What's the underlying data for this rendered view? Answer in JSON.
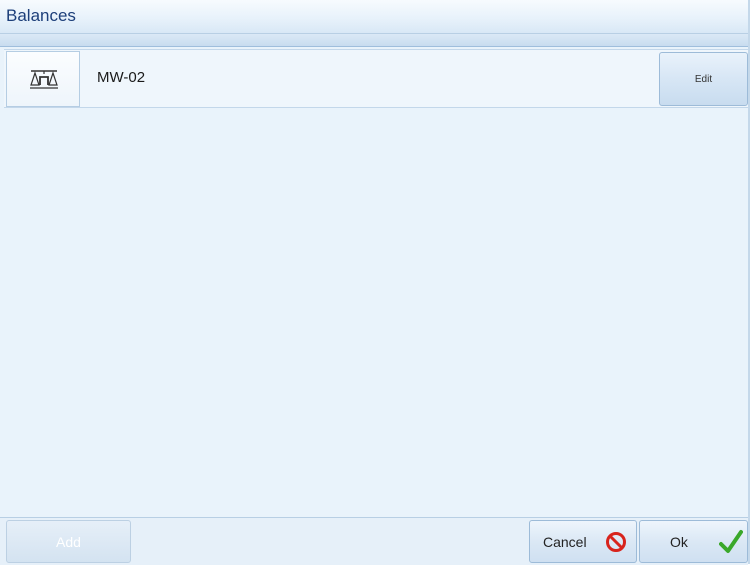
{
  "window": {
    "title": "Balances"
  },
  "balances": [
    {
      "name": "MW-02",
      "icon": "balance-scale-icon",
      "edit_label": "Edit"
    }
  ],
  "footer": {
    "add_label": "Add",
    "cancel_label": "Cancel",
    "cancel_icon": "prohibited-icon",
    "ok_label": "Ok",
    "ok_icon": "checkmark-icon"
  },
  "colors": {
    "title_text": "#1d3f7a",
    "background": "#e9f3fb",
    "cancel_icon": "#d8231c",
    "ok_icon": "#3aa82a"
  }
}
